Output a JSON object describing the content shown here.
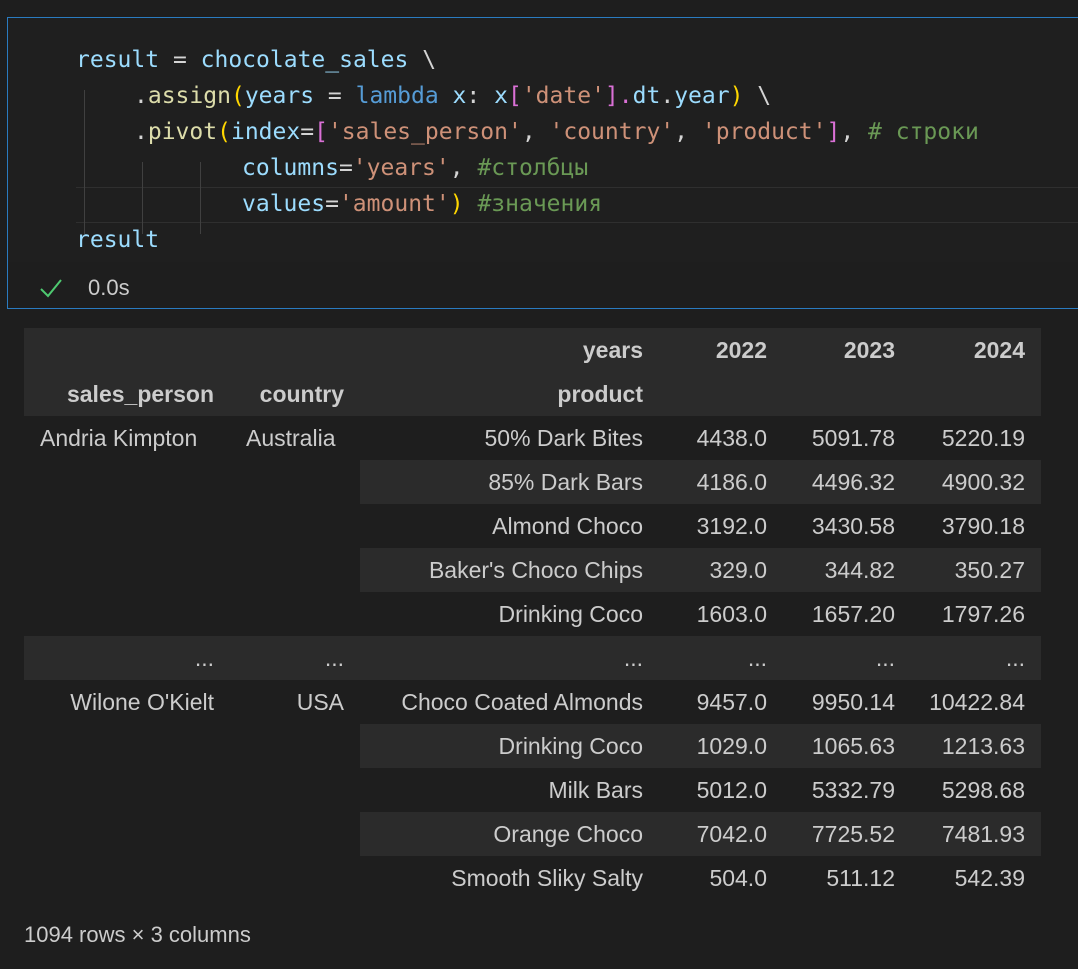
{
  "code": {
    "l1": {
      "a": "result",
      "b": " = ",
      "c": "chocolate_sales",
      "d": " \\"
    },
    "l2": {
      "a": ".",
      "b": "assign",
      "c": "(",
      "d": "years",
      "e": " = ",
      "f": "lambda",
      "g": " x",
      "h": ": ",
      "i": "x",
      "j": "[",
      "k": "'date'",
      "l": "].",
      "m": "dt",
      "n": ".",
      "o": "year",
      "p": ")",
      "q": " \\"
    },
    "l3": {
      "a": ".",
      "b": "pivot",
      "c": "(",
      "d": "index",
      "e": "=",
      "f": "[",
      "g": "'sales_person'",
      "h": ", ",
      "i": "'country'",
      "j": ", ",
      "k": "'product'",
      "l": "]",
      "m": ", ",
      "n": "# строки"
    },
    "l4": {
      "a": "columns",
      "b": "=",
      "c": "'years'",
      "d": ", ",
      "e": "#столбцы"
    },
    "l5": {
      "a": "values",
      "b": "=",
      "c": "'amount'",
      "d": ")",
      "e": " #значения"
    },
    "l6": {
      "a": "result"
    }
  },
  "status": {
    "duration": "0.0s",
    "icon": "check-icon"
  },
  "table": {
    "header_row1": {
      "label": "years",
      "columns": [
        "2022",
        "2023",
        "2024"
      ]
    },
    "header_row2": {
      "idx1": "sales_person",
      "idx2": "country",
      "idx3": "product"
    },
    "rows": [
      {
        "sales_person": "Andria Kimpton",
        "country": "Australia",
        "product": "50% Dark Bites",
        "v": [
          "4438.0",
          "5091.78",
          "5220.19"
        ]
      },
      {
        "sales_person": "",
        "country": "",
        "product": "85% Dark Bars",
        "v": [
          "4186.0",
          "4496.32",
          "4900.32"
        ]
      },
      {
        "sales_person": "",
        "country": "",
        "product": "Almond Choco",
        "v": [
          "3192.0",
          "3430.58",
          "3790.18"
        ]
      },
      {
        "sales_person": "",
        "country": "",
        "product": "Baker's Choco Chips",
        "v": [
          "329.0",
          "344.82",
          "350.27"
        ]
      },
      {
        "sales_person": "",
        "country": "",
        "product": "Drinking Coco",
        "v": [
          "1603.0",
          "1657.20",
          "1797.26"
        ]
      },
      {
        "sales_person": "...",
        "country": "...",
        "product": "...",
        "v": [
          "...",
          "...",
          "..."
        ]
      },
      {
        "sales_person": "Wilone O'Kielt",
        "country": "USA",
        "product": "Choco Coated Almonds",
        "v": [
          "9457.0",
          "9950.14",
          "10422.84"
        ]
      },
      {
        "sales_person": "",
        "country": "",
        "product": "Drinking Coco",
        "v": [
          "1029.0",
          "1065.63",
          "1213.63"
        ]
      },
      {
        "sales_person": "",
        "country": "",
        "product": "Milk Bars",
        "v": [
          "5012.0",
          "5332.79",
          "5298.68"
        ]
      },
      {
        "sales_person": "",
        "country": "",
        "product": "Orange Choco",
        "v": [
          "7042.0",
          "7725.52",
          "7481.93"
        ]
      },
      {
        "sales_person": "",
        "country": "",
        "product": "Smooth Sliky Salty",
        "v": [
          "504.0",
          "511.12",
          "542.39"
        ]
      }
    ]
  },
  "footer": "1094 rows × 3 columns"
}
